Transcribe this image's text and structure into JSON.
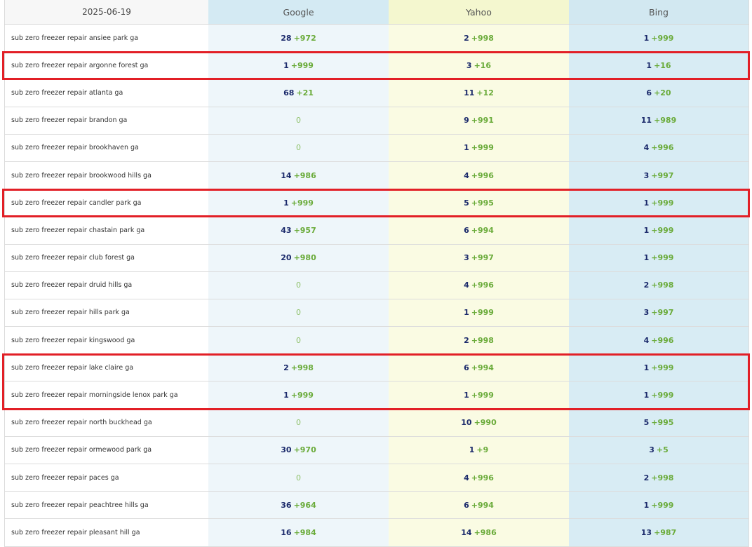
{
  "header": {
    "date": "2025-06-19",
    "engines": [
      "Google",
      "Yahoo",
      "Bing"
    ]
  },
  "rows": [
    {
      "keyword": "sub zero freezer repair ansiee park ga",
      "google": {
        "rank": "28",
        "change": "+972"
      },
      "yahoo": {
        "rank": "2",
        "change": "+998"
      },
      "bing": {
        "rank": "1",
        "change": "+999"
      }
    },
    {
      "keyword": "sub zero freezer repair argonne forest ga",
      "google": {
        "rank": "1",
        "change": "+999"
      },
      "yahoo": {
        "rank": "3",
        "change": "+16"
      },
      "bing": {
        "rank": "1",
        "change": "+16"
      }
    },
    {
      "keyword": "sub zero freezer repair atlanta ga",
      "google": {
        "rank": "68",
        "change": "+21"
      },
      "yahoo": {
        "rank": "11",
        "change": "+12"
      },
      "bing": {
        "rank": "6",
        "change": "+20"
      }
    },
    {
      "keyword": "sub zero freezer repair brandon ga",
      "google": {
        "rank": "",
        "change": "0"
      },
      "yahoo": {
        "rank": "9",
        "change": "+991"
      },
      "bing": {
        "rank": "11",
        "change": "+989"
      }
    },
    {
      "keyword": "sub zero freezer repair brookhaven ga",
      "google": {
        "rank": "",
        "change": "0"
      },
      "yahoo": {
        "rank": "1",
        "change": "+999"
      },
      "bing": {
        "rank": "4",
        "change": "+996"
      }
    },
    {
      "keyword": "sub zero freezer repair brookwood hills ga",
      "google": {
        "rank": "14",
        "change": "+986"
      },
      "yahoo": {
        "rank": "4",
        "change": "+996"
      },
      "bing": {
        "rank": "3",
        "change": "+997"
      }
    },
    {
      "keyword": "sub zero freezer repair candler park ga",
      "google": {
        "rank": "1",
        "change": "+999"
      },
      "yahoo": {
        "rank": "5",
        "change": "+995"
      },
      "bing": {
        "rank": "1",
        "change": "+999"
      }
    },
    {
      "keyword": "sub zero freezer repair chastain park ga",
      "google": {
        "rank": "43",
        "change": "+957"
      },
      "yahoo": {
        "rank": "6",
        "change": "+994"
      },
      "bing": {
        "rank": "1",
        "change": "+999"
      }
    },
    {
      "keyword": "sub zero freezer repair club forest ga",
      "google": {
        "rank": "20",
        "change": "+980"
      },
      "yahoo": {
        "rank": "3",
        "change": "+997"
      },
      "bing": {
        "rank": "1",
        "change": "+999"
      }
    },
    {
      "keyword": "sub zero freezer repair druid hills ga",
      "google": {
        "rank": "",
        "change": "0"
      },
      "yahoo": {
        "rank": "4",
        "change": "+996"
      },
      "bing": {
        "rank": "2",
        "change": "+998"
      }
    },
    {
      "keyword": "sub zero freezer repair hills park ga",
      "google": {
        "rank": "",
        "change": "0"
      },
      "yahoo": {
        "rank": "1",
        "change": "+999"
      },
      "bing": {
        "rank": "3",
        "change": "+997"
      }
    },
    {
      "keyword": "sub zero freezer repair kingswood ga",
      "google": {
        "rank": "",
        "change": "0"
      },
      "yahoo": {
        "rank": "2",
        "change": "+998"
      },
      "bing": {
        "rank": "4",
        "change": "+996"
      }
    },
    {
      "keyword": "sub zero freezer repair lake claire ga",
      "google": {
        "rank": "2",
        "change": "+998"
      },
      "yahoo": {
        "rank": "6",
        "change": "+994"
      },
      "bing": {
        "rank": "1",
        "change": "+999"
      }
    },
    {
      "keyword": "sub zero freezer repair morningside lenox park ga",
      "google": {
        "rank": "1",
        "change": "+999"
      },
      "yahoo": {
        "rank": "1",
        "change": "+999"
      },
      "bing": {
        "rank": "1",
        "change": "+999"
      }
    },
    {
      "keyword": "sub zero freezer repair north buckhead ga",
      "google": {
        "rank": "",
        "change": "0"
      },
      "yahoo": {
        "rank": "10",
        "change": "+990"
      },
      "bing": {
        "rank": "5",
        "change": "+995"
      }
    },
    {
      "keyword": "sub zero freezer repair ormewood park ga",
      "google": {
        "rank": "30",
        "change": "+970"
      },
      "yahoo": {
        "rank": "1",
        "change": "+9"
      },
      "bing": {
        "rank": "3",
        "change": "+5"
      }
    },
    {
      "keyword": "sub zero freezer repair paces ga",
      "google": {
        "rank": "",
        "change": "0"
      },
      "yahoo": {
        "rank": "4",
        "change": "+996"
      },
      "bing": {
        "rank": "2",
        "change": "+998"
      }
    },
    {
      "keyword": "sub zero freezer repair peachtree hills ga",
      "google": {
        "rank": "36",
        "change": "+964"
      },
      "yahoo": {
        "rank": "6",
        "change": "+994"
      },
      "bing": {
        "rank": "1",
        "change": "+999"
      }
    },
    {
      "keyword": "sub zero freezer repair pleasant hill ga",
      "google": {
        "rank": "16",
        "change": "+984"
      },
      "yahoo": {
        "rank": "14",
        "change": "+986"
      },
      "bing": {
        "rank": "13",
        "change": "+987"
      }
    }
  ],
  "highlighted_rows": [
    1,
    6,
    12,
    13
  ],
  "colors": {
    "highlight": "#e21f26",
    "rank": "#1b2a6b",
    "change": "#6aab3a"
  }
}
